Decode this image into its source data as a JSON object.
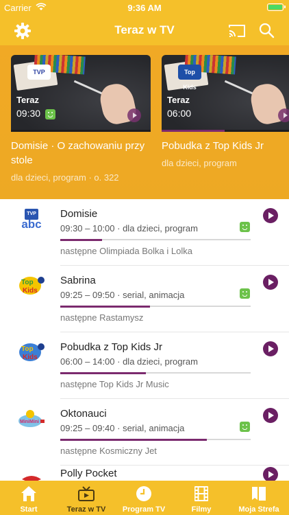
{
  "status_bar": {
    "carrier": "Carrier",
    "time": "9:36 AM"
  },
  "nav": {
    "title": "Teraz w TV",
    "icons": [
      "gear-icon",
      "cast-icon",
      "search-icon"
    ]
  },
  "featured": [
    {
      "channel_logo": "TVP",
      "now_label": "Teraz",
      "time": "09:30",
      "title": "Domisie · O zachowaniu przy stole",
      "meta": "dla dzieci, program · o. 322",
      "progress": 0.0
    },
    {
      "channel_logo": "Top Kids",
      "now_label": "Teraz",
      "time": "06:00",
      "title": "Pobudka z Top Kids Jr",
      "meta": "dla dzieci, program",
      "progress": 0.45
    }
  ],
  "list": [
    {
      "title": "Domisie",
      "time_info": "09:30 – 10:00 · dla dzieci, program",
      "kids_badge": true,
      "progress": 0.22,
      "next": "następne Olimpiada Bolka i Lolka"
    },
    {
      "title": "Sabrina",
      "time_info": "09:25 – 09:50 · serial, animacja",
      "kids_badge": true,
      "progress": 0.47,
      "next": "następne Rastamysz"
    },
    {
      "title": "Pobudka z Top Kids Jr",
      "time_info": "06:00 – 14:00 · dla dzieci, program",
      "kids_badge": false,
      "progress": 0.45,
      "next": "następne Top Kids Jr Music"
    },
    {
      "title": "Oktonauci",
      "time_info": "09:25 – 09:40 · serial, animacja",
      "kids_badge": true,
      "progress": 0.77,
      "next": "następne Kosmiczny Jet"
    },
    {
      "title": "Polly Pocket",
      "time_info": "",
      "kids_badge": false,
      "progress": 0.0,
      "next": ""
    }
  ],
  "tabs": [
    {
      "label": "Start",
      "icon": "home-icon",
      "active": false
    },
    {
      "label": "Teraz w TV",
      "icon": "tv-icon",
      "active": true
    },
    {
      "label": "Program TV",
      "icon": "clock-icon",
      "active": false
    },
    {
      "label": "Filmy",
      "icon": "film-icon",
      "active": false
    },
    {
      "label": "Moja Strefa",
      "icon": "bookmark-icon",
      "active": false
    }
  ],
  "colors": {
    "accent": "#f5c02a",
    "progress": "#7b2a6e",
    "play": "#6a1f63",
    "kids": "#6cc24a"
  }
}
